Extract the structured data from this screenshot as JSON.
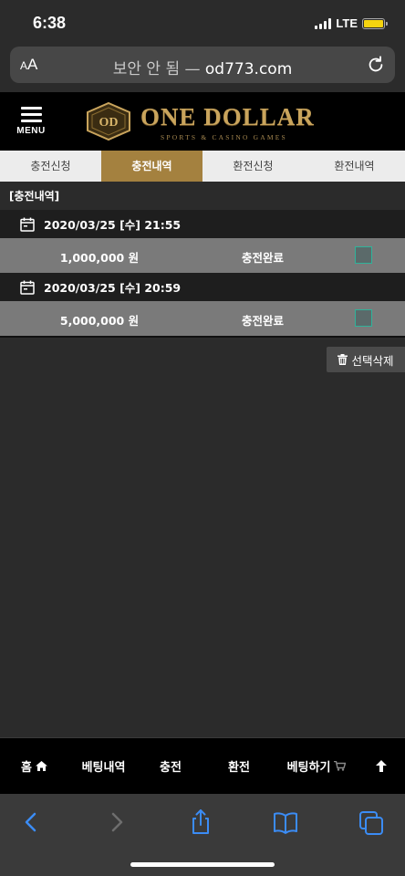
{
  "status_bar": {
    "time": "6:38",
    "network": "LTE",
    "battery_color": "#f5d40f"
  },
  "browser": {
    "text_size_label_small": "A",
    "text_size_label_large": "A",
    "security_label": "보안 안 됨",
    "separator": "—",
    "domain": "od773.com"
  },
  "header": {
    "menu_label": "MENU",
    "logo_title": "ONE DOLLAR",
    "logo_subtitle": "SPORTS & CASINO GAMES",
    "logo_emblem": "OD"
  },
  "tabs": [
    {
      "label": "충전신청",
      "active": false
    },
    {
      "label": "충전내역",
      "active": true
    },
    {
      "label": "환전신청",
      "active": false
    },
    {
      "label": "환전내역",
      "active": false
    }
  ],
  "section_title": "[충전내역]",
  "records": [
    {
      "datetime": "2020/03/25 [수] 21:55",
      "amount": "1,000,000 원",
      "status": "충전완료"
    },
    {
      "datetime": "2020/03/25 [수] 20:59",
      "amount": "5,000,000 원",
      "status": "충전완료"
    }
  ],
  "delete_button": {
    "label": "선택삭제"
  },
  "bottom_nav": {
    "home": "홈",
    "bet_history": "베팅내역",
    "charge": "충전",
    "exchange": "환전",
    "betting": "베팅하기"
  },
  "colors": {
    "accent": "#a4813f",
    "row_bg": "#7a7a7a",
    "checkbox_border": "#2fb39a"
  }
}
